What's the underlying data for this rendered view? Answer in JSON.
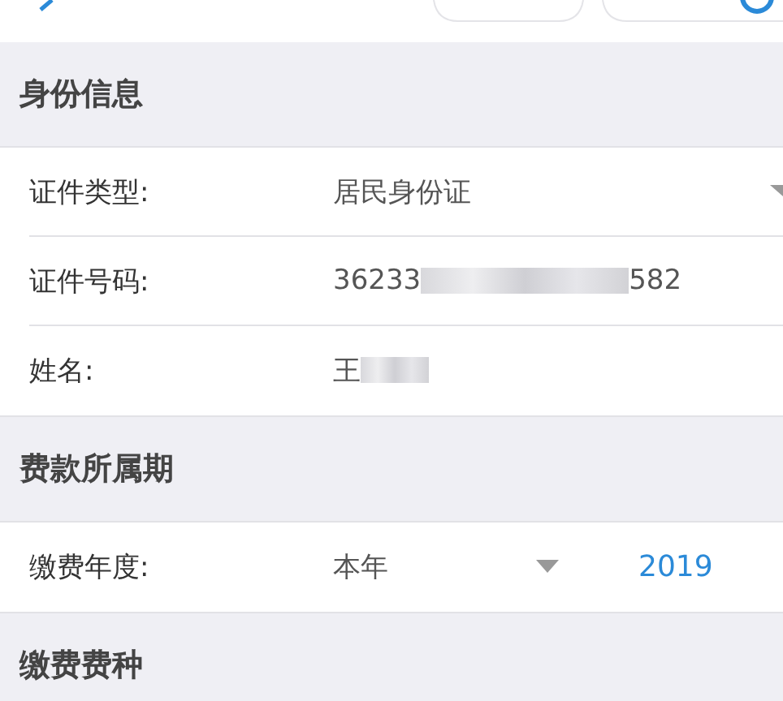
{
  "sections": [
    {
      "title": "身份信息",
      "rows": [
        {
          "kind": "dropdown",
          "label": "证件类型:",
          "parts": [
            {
              "kind": "text",
              "text": "居民身份证"
            }
          ]
        },
        {
          "kind": "plain",
          "label": "证件号码:",
          "parts": [
            {
              "kind": "text",
              "text": "36233"
            },
            {
              "kind": "blur"
            },
            {
              "kind": "text",
              "text": "582"
            }
          ]
        },
        {
          "kind": "plain",
          "label": "姓名:",
          "parts": [
            {
              "kind": "text",
              "text": "王"
            },
            {
              "kind": "blur"
            }
          ]
        }
      ]
    },
    {
      "title": "费款所属期",
      "rows": [
        {
          "kind": "year",
          "label": "缴费年度:",
          "parts": [
            {
              "kind": "text",
              "text": "本年"
            }
          ],
          "year": "2019"
        }
      ]
    },
    {
      "title": "缴费费种"
    }
  ]
}
